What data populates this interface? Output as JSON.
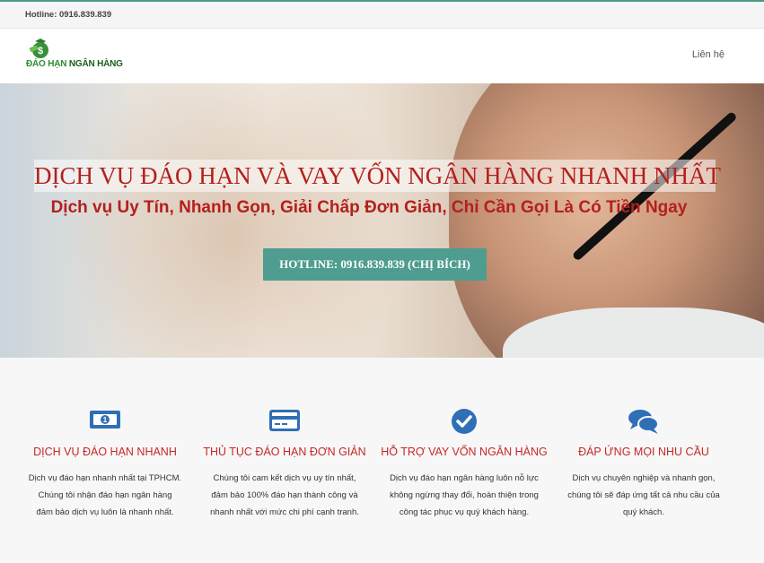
{
  "topbar": {
    "hotline": "Hotline: 0916.839.839"
  },
  "header": {
    "logo": {
      "part1": "ĐÁO HẠN",
      "part2": " NGÂN HÀNG"
    },
    "nav_contact": "Liên hệ"
  },
  "hero": {
    "title": "DỊCH VỤ ĐÁO HẠN VÀ VAY VỐN NGÂN HÀNG NHANH NHẤT",
    "subtitle": "Dịch vụ Uy Tín, Nhanh Gọn, Giải Chấp Đơn Giản, Chỉ Cần Gọi Là Có Tiền Ngay",
    "button": "HOTLINE: 0916.839.839 (CHỊ BÍCH)"
  },
  "features": [
    {
      "icon": "money-icon",
      "title": "DỊCH VỤ ĐÁO HẠN NHANH",
      "lines": [
        "Dịch vụ đáo hạn nhanh nhất tại TPHCM.",
        "Chúng tôi nhận đáo hạn ngân hàng",
        "đảm bảo dịch vụ luôn là nhanh nhất."
      ]
    },
    {
      "icon": "credit-card-icon",
      "title": "THỦ TỤC ĐÁO HẠN ĐƠN GIẢN",
      "lines": [
        "Chúng tôi cam kết dịch vụ uy tín nhất,",
        "đảm bảo 100% đáo hạn thành công và",
        "nhanh nhất với mức chi phí cạnh tranh."
      ]
    },
    {
      "icon": "check-circle-icon",
      "title": "HỖ TRỢ VAY VỐN NGÂN HÀNG",
      "lines": [
        "Dịch vụ đáo hạn ngân hàng luôn nỗ lực",
        "không ngừng thay đổi, hoàn thiện trong",
        "công tác phục vụ quý khách hàng."
      ]
    },
    {
      "icon": "comments-icon",
      "title": "ĐÁP ỨNG MỌI NHU CẦU",
      "lines": [
        "Dịch vụ chuyên nghiệp và nhanh gọn,",
        "chúng tôi sẽ đáp ứng tất cả nhu cầu của",
        "quý khách."
      ]
    }
  ],
  "colors": {
    "accent": "#4f9c90",
    "title_red": "#b3201d",
    "feature_red": "#c62828",
    "icon_blue": "#2f6fb5"
  }
}
